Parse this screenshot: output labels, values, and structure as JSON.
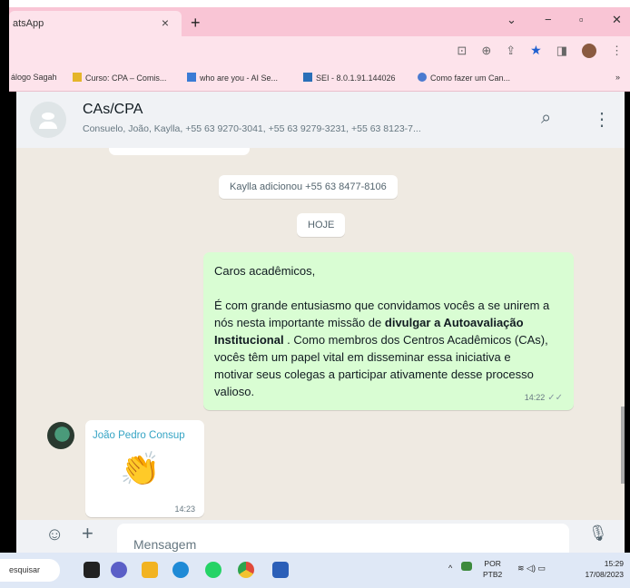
{
  "browser": {
    "tab_title": "atsApp",
    "tab_close": "×",
    "new_tab": "+",
    "window_controls": {
      "tabs_menu": "⌄",
      "minimize": "−",
      "restore": "▫",
      "close": "✕"
    },
    "address_icons": {
      "install": "⊡",
      "zoom": "⊕",
      "share": "⇪",
      "bookmark": "★",
      "sidebar": "◨",
      "menu": "⋮"
    },
    "bookmarks": [
      {
        "label": "álogo Sagah",
        "color": "#ffffff"
      },
      {
        "label": "Curso: CPA – Comis...",
        "color": "#e5b52a"
      },
      {
        "label": "who are you - AI Se...",
        "color": "#3a7bd5"
      },
      {
        "label": "SEI - 8.0.1.91.144026",
        "color": "#2a6fb8"
      },
      {
        "label": "Como fazer um Can...",
        "color": "#4a7ad0"
      }
    ],
    "bookmarks_more": "»"
  },
  "chat": {
    "title": "CAs/CPA",
    "members": "Consuelo, João, Kaylla, +55 63 9270-3041, +55 63 9279-3231, +55 63 8123-7...",
    "search_icon": "⌕",
    "menu_icon": "⋮",
    "system_messages": [
      {
        "text": "Kaylla adicionou +55 63 8477-8106"
      },
      {
        "text": "HOJE"
      }
    ],
    "outgoing": {
      "greeting": "Caros acadêmicos,",
      "body_start": "É com grande entusiasmo que convidamos vocês a se unirem a nós nesta importante missão de ",
      "body_bold": "divulgar a Autoavaliação Institucional",
      "body_end": " . Como membros dos Centros Acadêmicos (CAs), vocês têm um papel vital em disseminar essa iniciativa e motivar seus colegas a participar ativamente desse processo valioso.",
      "time": "14:22",
      "status": "✓✓"
    },
    "incoming": {
      "sender": "João Pedro Consup",
      "emoji": "👏",
      "time": "14:23"
    }
  },
  "composer": {
    "emoji_icon": "☺",
    "attach_icon": "+",
    "placeholder": "Mensagem",
    "mic_icon": "🎙"
  },
  "taskbar": {
    "search_label": "esquisar",
    "apps": [
      {
        "name": "task-view",
        "color": "#222222"
      },
      {
        "name": "teams",
        "color": "#5b5fc7"
      },
      {
        "name": "file-explorer",
        "color": "#f2b321"
      },
      {
        "name": "edge",
        "color": "#1f8ad6"
      },
      {
        "name": "whatsapp",
        "color": "#25d366"
      },
      {
        "name": "chrome",
        "color": "#e04a3a"
      },
      {
        "name": "word",
        "color": "#2b5fb8"
      }
    ],
    "tray_chevron": "^",
    "lang": "POR",
    "lang_sub": "PTB2",
    "tray_icons": "≋ ◁) ▭",
    "time": "15:29",
    "date": "17/08/2023"
  },
  "colors": {
    "outgoing_bubble": "#d9fdd3",
    "chat_bg": "#efeae2",
    "sender_name": "#35a4c4",
    "browser_tab": "#f9c5d5"
  }
}
